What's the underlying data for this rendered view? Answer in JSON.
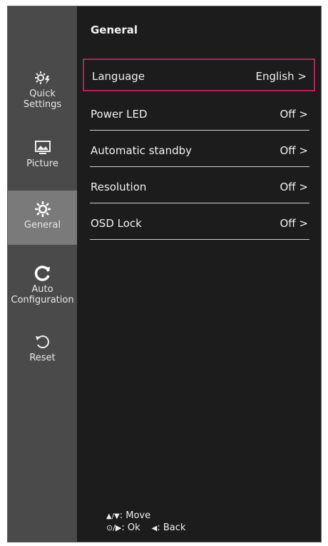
{
  "sidebar": {
    "items": [
      {
        "label_line1": "Quick",
        "label_line2": "Settings",
        "icon": "quick-settings-icon",
        "active": false
      },
      {
        "label_line1": "Picture",
        "label_line2": "",
        "icon": "picture-icon",
        "active": false
      },
      {
        "label_line1": "General",
        "label_line2": "",
        "icon": "general-gear-icon",
        "active": true
      },
      {
        "label_line1": "Auto",
        "label_line2": "Configuration",
        "icon": "auto-configuration-icon",
        "active": false
      },
      {
        "label_line1": "Reset",
        "label_line2": "",
        "icon": "reset-icon",
        "active": false
      }
    ]
  },
  "main": {
    "title": "General",
    "rows": [
      {
        "label": "Language",
        "value": "English",
        "chevron": ">"
      },
      {
        "label": "Power LED",
        "value": "Off",
        "chevron": ">"
      },
      {
        "label": "Automatic standby",
        "value": "Off",
        "chevron": ">"
      },
      {
        "label": "Resolution",
        "value": "Off",
        "chevron": ">"
      },
      {
        "label": "OSD Lock",
        "value": "Off",
        "chevron": ">"
      }
    ]
  },
  "footer": {
    "move_keys": "▲/▼",
    "move_label": ": Move",
    "ok_keys": "⊙/▶",
    "ok_label": ": Ok",
    "back_key": "◀",
    "back_label": ": Back"
  },
  "colors": {
    "selection_border": "#b0245a",
    "sidebar_bg": "#4a4a4a",
    "sidebar_active_bg": "#7a7a7a",
    "panel_bg": "#1c1c1c"
  }
}
